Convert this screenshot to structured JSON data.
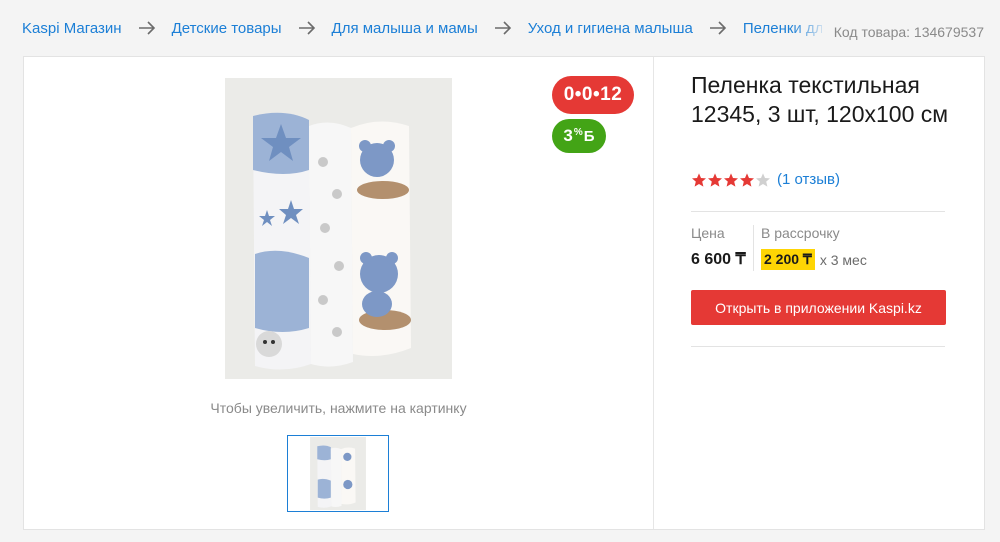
{
  "breadcrumb": [
    {
      "label": "Kaspi Магазин"
    },
    {
      "label": "Детские товары"
    },
    {
      "label": "Для малыша и мамы"
    },
    {
      "label": "Уход и гигиена малыша"
    },
    {
      "label": "Пеленки для малыша"
    }
  ],
  "product": {
    "sku_text": "Код товара: 134679537",
    "title": "Пеленка текстильная 12345, 3 шт, 120х100 см",
    "rating": 4,
    "rating_max": 5,
    "reviews_text": "(1 отзыв)",
    "zoom_hint": "Чтобы увеличить, нажмите на картинку"
  },
  "badges": {
    "credit": "0•0•12",
    "bonus_value": "3",
    "bonus_percent": "%",
    "bonus_currency": "Б"
  },
  "pricing": {
    "price_label": "Цена",
    "price_value": "6 600 ₸",
    "installment_label": "В рассрочку",
    "installment_monthly": "2 200 ₸",
    "installment_term": "х 3 мес"
  },
  "actions": {
    "open_app_label": "Открыть в приложении Kaspi.kz"
  },
  "colors": {
    "link": "#1c7fd6",
    "accent_red": "#e53935",
    "bonus_green": "#43a416",
    "installment_yellow": "#fed504",
    "star_filled": "#e53935",
    "star_empty": "#d0d0d0"
  },
  "icons": {
    "breadcrumb_separator": "arrow-right-icon",
    "rating": "star-icon"
  }
}
